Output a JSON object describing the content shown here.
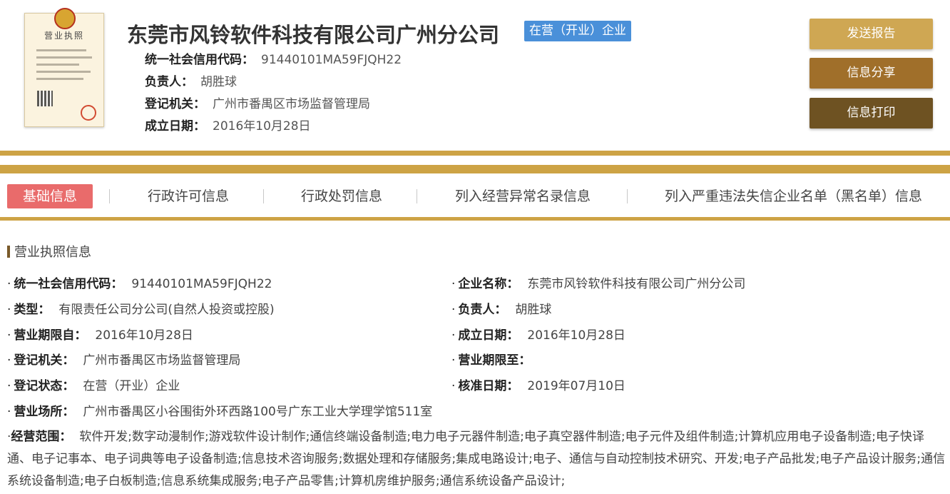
{
  "license_thumbnail": {
    "title": "营业执照"
  },
  "header": {
    "company_name": "东莞市风铃软件科技有限公司广州分公司",
    "status_badge": "在营（开业）企业",
    "fields": [
      {
        "label": "统一社会信用代码：",
        "value": "91440101MA59FJQH22"
      },
      {
        "label": "负责人：",
        "value": "胡胜球"
      },
      {
        "label": "登记机关：",
        "value": "广州市番禺区市场监督管理局"
      },
      {
        "label": "成立日期：",
        "value": "2016年10月28日"
      }
    ]
  },
  "actions": {
    "send_report": "发送报告",
    "share_info": "信息分享",
    "print_info": "信息打印"
  },
  "tabs": [
    {
      "label": "基础信息"
    },
    {
      "label": "行政许可信息"
    },
    {
      "label": "行政处罚信息"
    },
    {
      "label": "列入经营异常名录信息"
    },
    {
      "label": "列入严重违法失信企业名单（黑名单）信息"
    }
  ],
  "section": {
    "title": "营业执照信息",
    "left": [
      {
        "label": "统一社会信用代码：",
        "value": "91440101MA59FJQH22"
      },
      {
        "label": "类型：",
        "value": "有限责任公司分公司(自然人投资或控股)"
      },
      {
        "label": "营业期限自：",
        "value": "2016年10月28日"
      },
      {
        "label": "登记机关：",
        "value": "广州市番禺区市场监督管理局"
      },
      {
        "label": "登记状态：",
        "value": "在营（开业）企业"
      },
      {
        "label": "营业场所：",
        "value": "广州市番禺区小谷围街外环西路100号广东工业大学理学馆511室"
      }
    ],
    "right": [
      {
        "label": "企业名称：",
        "value": "东莞市风铃软件科技有限公司广州分公司"
      },
      {
        "label": "负责人：",
        "value": "胡胜球"
      },
      {
        "label": "成立日期：",
        "value": "2016年10月28日"
      },
      {
        "label": "营业期限至：",
        "value": ""
      },
      {
        "label": "核准日期：",
        "value": "2019年07月10日"
      }
    ],
    "scope": {
      "label": "经营范围：",
      "value": "软件开发;数字动漫制作;游戏软件设计制作;通信终端设备制造;电力电子元器件制造;电子真空器件制造;电子元件及组件制造;计算机应用电子设备制造;电子快译通、电子记事本、电子词典等电子设备制造;信息技术咨询服务;数据处理和存储服务;集成电路设计;电子、通信与自动控制技术研究、开发;电子产品批发;电子产品设计服务;通信系统设备制造;电子白板制造;信息系统集成服务;电子产品零售;计算机房维护服务;通信系统设备产品设计;"
    }
  },
  "colors": {
    "gold": "#cda345",
    "badge_blue": "#4a90d9",
    "active_tab": "#e96b6b",
    "btn_send": "#cfa753",
    "btn_share": "#a06f2a",
    "btn_print": "#6e5222"
  }
}
